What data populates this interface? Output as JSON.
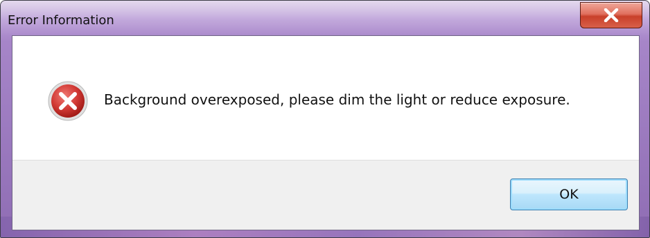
{
  "window": {
    "title": "Error Information",
    "close_icon": "close-icon"
  },
  "dialog": {
    "icon": "error-icon",
    "message": "Background overexposed, please dim the light or reduce exposure.",
    "ok_label": "OK"
  },
  "colors": {
    "error_red": "#d23a35",
    "close_button_red": "#c8402a",
    "ok_button_border": "#3c7fb1"
  }
}
